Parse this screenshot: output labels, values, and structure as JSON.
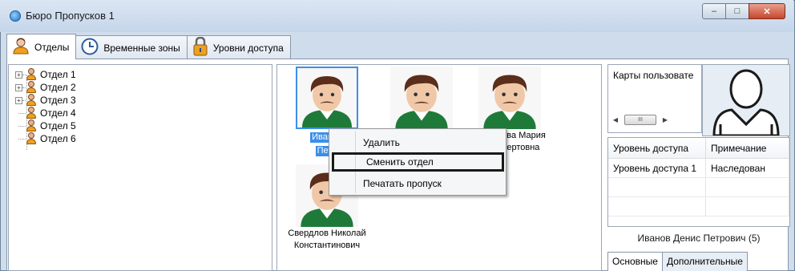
{
  "window": {
    "title": "Бюро Пропусков 1",
    "buttons": {
      "minimize": "–",
      "maximize": "□",
      "close": "✕"
    }
  },
  "tabs": [
    {
      "label": "Отделы",
      "icon": "user-icon",
      "active": true
    },
    {
      "label": "Временные зоны",
      "icon": "clock-icon",
      "active": false
    },
    {
      "label": "Уровни доступа",
      "icon": "lock-icon",
      "active": false
    }
  ],
  "tree": {
    "items": [
      {
        "label": "Отдел 1",
        "expandable": true,
        "expander": "+"
      },
      {
        "label": "Отдел 2",
        "expandable": true,
        "expander": "+"
      },
      {
        "label": "Отдел 3",
        "expandable": true,
        "expander": "+"
      },
      {
        "label": "Отдел 4",
        "expandable": false
      },
      {
        "label": "Отдел 5",
        "expandable": false
      },
      {
        "label": "Отдел 6",
        "expandable": false
      }
    ]
  },
  "users": [
    {
      "line1": "Иванов",
      "line2": "Петр",
      "selected": true
    },
    {
      "line1": "",
      "line2": "",
      "selected": false
    },
    {
      "line1": "анова Мария",
      "line2": "льбертовна",
      "selected": false
    },
    {
      "line1": "Свердлов Николай",
      "line2": "Константинович",
      "selected": false
    }
  ],
  "context_menu": {
    "items": [
      {
        "label": "Удалить",
        "highlighted": false
      },
      {
        "label": "Сменить отдел",
        "highlighted": true
      },
      {
        "label": "Печатать пропуск",
        "highlighted": false
      }
    ]
  },
  "cards_box": {
    "header": "Карты пользовате",
    "scroll_thumb": "III"
  },
  "access_grid": {
    "columns": [
      "Уровень доступа",
      "Примечание"
    ],
    "rows": [
      [
        "Уровень доступа 1",
        "Наследован"
      ]
    ]
  },
  "person_label": "Иванов Денис Петрович (5)",
  "sub_tabs": [
    {
      "label": "Основные",
      "active": true
    },
    {
      "label": "Дополнительные",
      "active": false
    }
  ],
  "colors": {
    "selection": "#3c8fe8",
    "shirt": "#1f7a3a",
    "skin": "#f0c8a8",
    "hair": "#5a2e1a"
  }
}
